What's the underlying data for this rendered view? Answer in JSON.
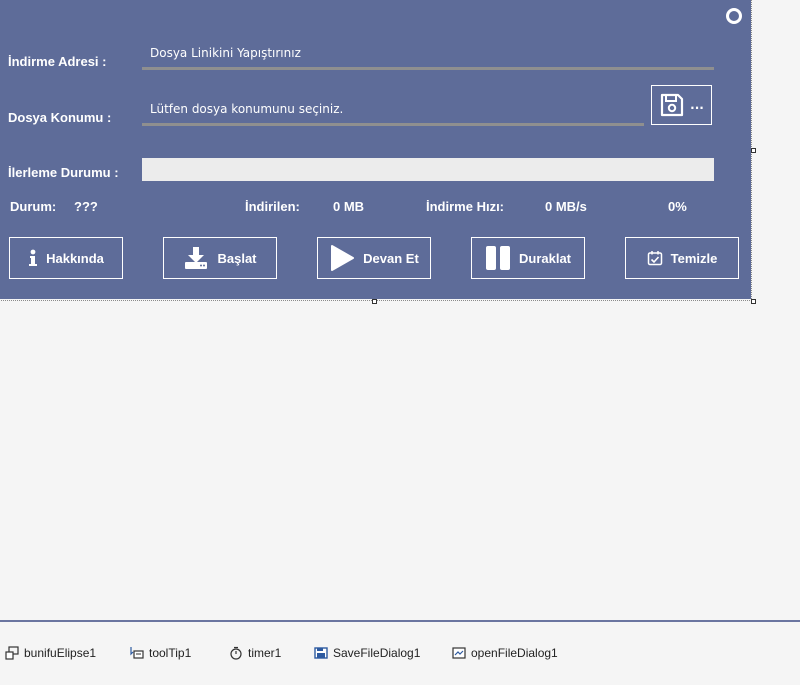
{
  "form": {
    "url_label": "İndirme Adresi :",
    "url_value": "Dosya Linikini Yapıştırınız",
    "location_label": "Dosya Konumu :",
    "location_value": "Lütfen dosya konumunu seçiniz.",
    "browse_label": "...",
    "progress_label": "İlerleme Durumu :",
    "progress_fraction": 0,
    "status_label": "Durum:",
    "status_value": "???",
    "downloaded_label": "İndirilen:",
    "downloaded_value": "0 MB",
    "speed_label": "İndirme Hızı:",
    "speed_value": "0 MB/s",
    "percent_value": "0%"
  },
  "buttons": {
    "about": "Hakkında",
    "start": "Başlat",
    "resume": "Devan Et",
    "pause": "Duraklat",
    "clear": "Temizle"
  },
  "tray": {
    "items": [
      "bunifuElipse1",
      "toolTip1",
      "timer1",
      "SaveFileDialog1",
      "openFileDialog1"
    ]
  },
  "colors": {
    "form_bg": "#5e6c99",
    "tray_border": "#6b75a0"
  }
}
